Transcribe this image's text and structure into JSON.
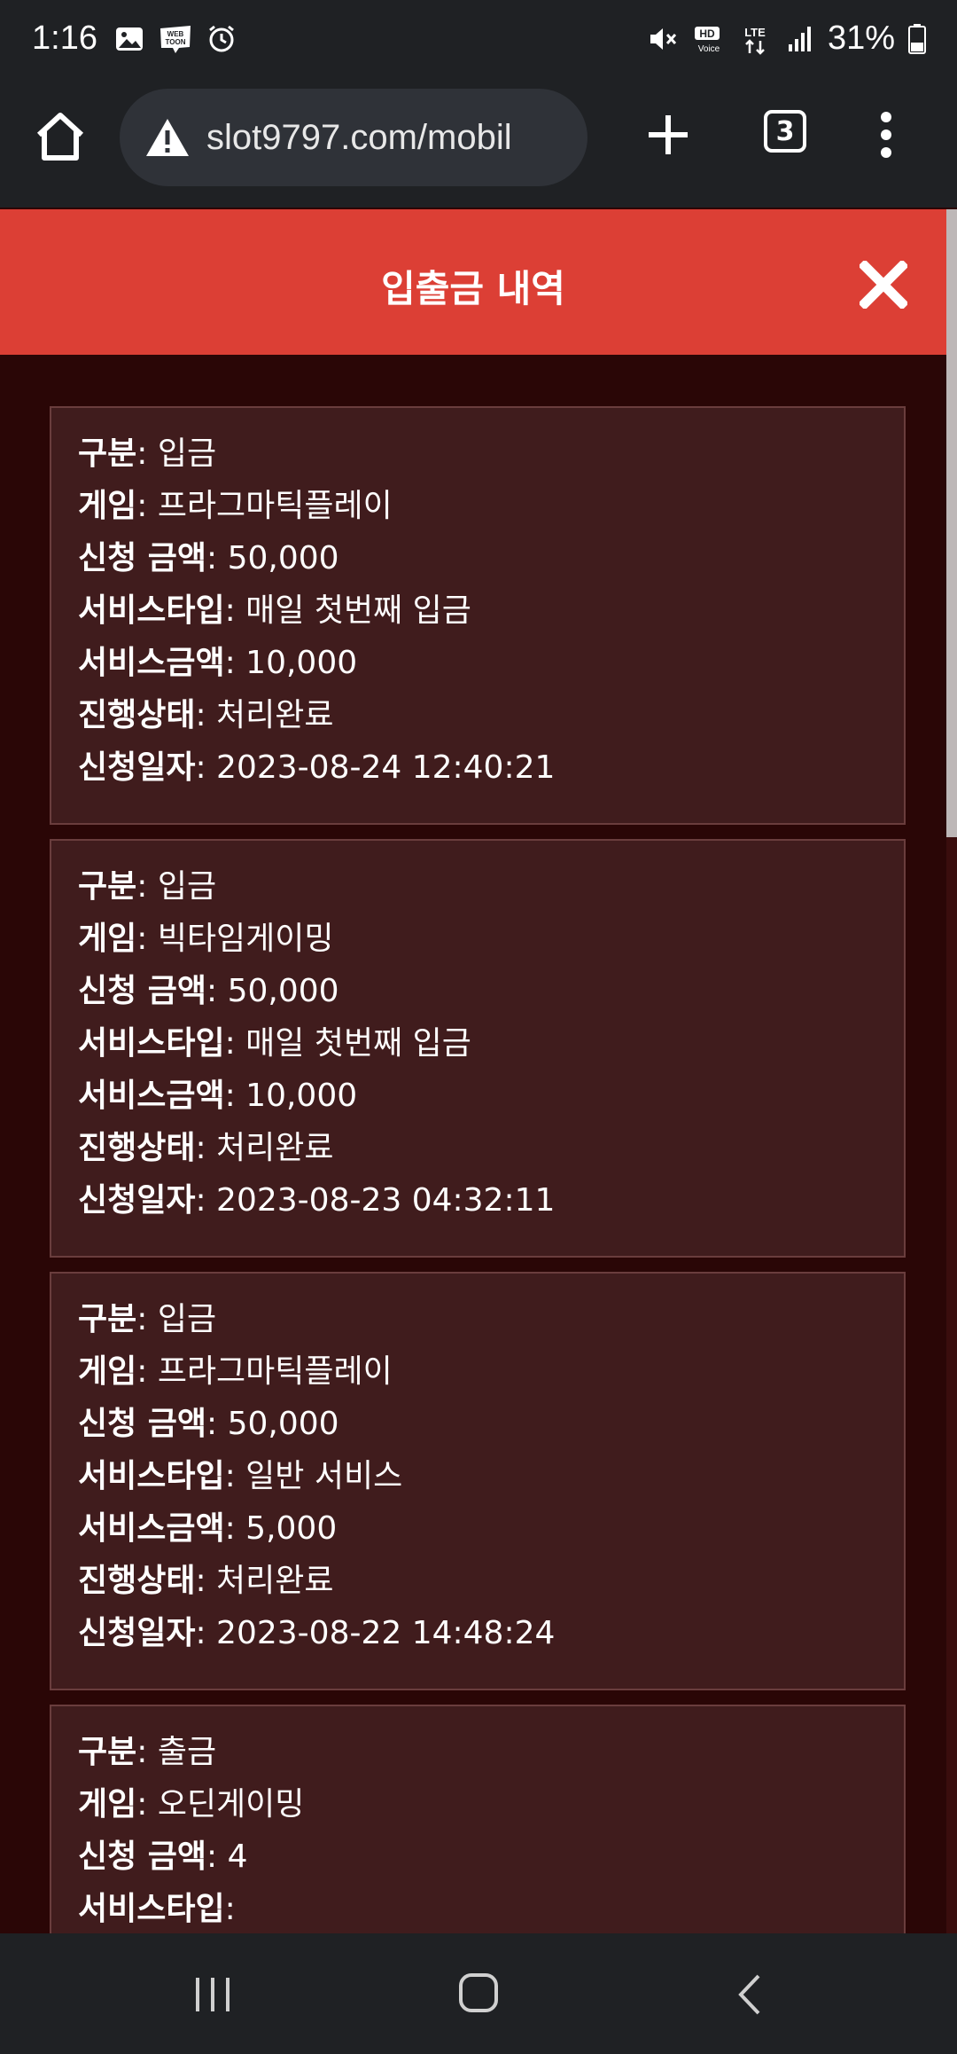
{
  "status_bar": {
    "time": "1:16",
    "battery": "31%",
    "left_icons": [
      "gallery-icon",
      "webtoon-icon",
      "alarm-icon"
    ],
    "right_icons": [
      "mute-icon",
      "hd-voice-icon",
      "lte-icon",
      "signal-icon",
      "battery-icon"
    ]
  },
  "browser": {
    "url": "slot9797.com/mobil",
    "tab_count": "3"
  },
  "modal": {
    "title": "입출금 내역"
  },
  "records": [
    {
      "rows": [
        {
          "label": "구분",
          "value": ": 입금"
        },
        {
          "label": "게임",
          "value": ": 프라그마틱플레이"
        },
        {
          "label": "신청 금액",
          "value": ": 50,000"
        },
        {
          "label": "서비스타입",
          "value": ": 매일 첫번째 입금"
        },
        {
          "label": "서비스금액",
          "value": ": 10,000"
        },
        {
          "label": "진행상태",
          "value": ": 처리완료"
        },
        {
          "label": "신청일자",
          "value": ": 2023-08-24 12:40:21"
        }
      ]
    },
    {
      "rows": [
        {
          "label": "구분",
          "value": ": 입금"
        },
        {
          "label": "게임",
          "value": ": 빅타임게이밍"
        },
        {
          "label": "신청 금액",
          "value": ": 50,000"
        },
        {
          "label": "서비스타입",
          "value": ": 매일 첫번째 입금"
        },
        {
          "label": "서비스금액",
          "value": ": 10,000"
        },
        {
          "label": "진행상태",
          "value": ": 처리완료"
        },
        {
          "label": "신청일자",
          "value": ": 2023-08-23 04:32:11"
        }
      ]
    },
    {
      "rows": [
        {
          "label": "구분",
          "value": ": 입금"
        },
        {
          "label": "게임",
          "value": ": 프라그마틱플레이"
        },
        {
          "label": "신청 금액",
          "value": ": 50,000"
        },
        {
          "label": "서비스타입",
          "value": ": 일반 서비스"
        },
        {
          "label": "서비스금액",
          "value": ": 5,000"
        },
        {
          "label": "진행상태",
          "value": ": 처리완료"
        },
        {
          "label": "신청일자",
          "value": ": 2023-08-22 14:48:24"
        }
      ]
    },
    {
      "rows": [
        {
          "label": "구분",
          "value": ": 출금"
        },
        {
          "label": "게임",
          "value": ": 오딘게이밍"
        },
        {
          "label": "신청 금액",
          "value": ": 4"
        },
        {
          "label": "서비스타입",
          "value": ":"
        }
      ]
    }
  ],
  "colors": {
    "header": "#dc3f35",
    "background": "#2a0606",
    "card": "#401c1d",
    "card_border": "#6a3d3d"
  }
}
